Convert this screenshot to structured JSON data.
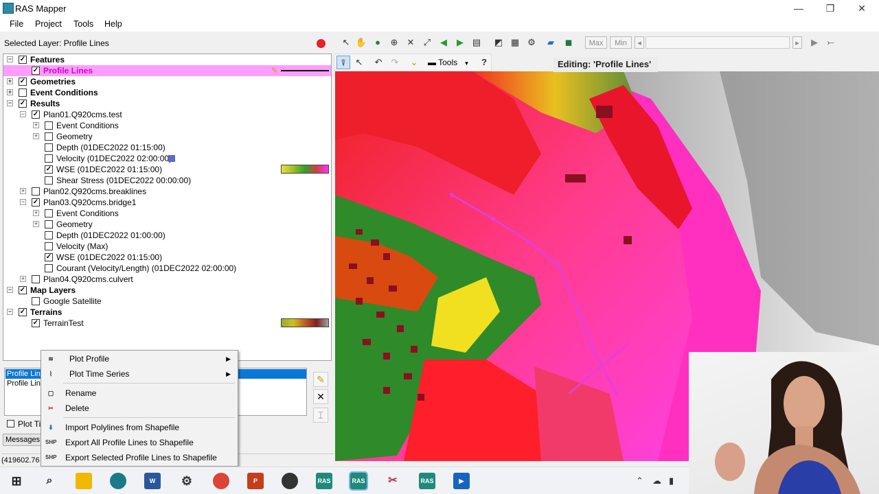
{
  "window": {
    "title": "RAS Mapper",
    "minimize": "—",
    "maximize": "❐",
    "close": "✕"
  },
  "menu": [
    "File",
    "Project",
    "Tools",
    "Help"
  ],
  "selected_layer": "Selected Layer: Profile Lines",
  "tree": [
    {
      "label": "Features",
      "bold": true,
      "checked": true,
      "expander": "−",
      "indent": 0
    },
    {
      "label": "Profile Lines",
      "checked": true,
      "indent": 1,
      "highlight": true
    },
    {
      "label": "Geometries",
      "bold": true,
      "checked": true,
      "expander": "+",
      "indent": 0
    },
    {
      "label": "Event Conditions",
      "bold": true,
      "checked": false,
      "expander": "+",
      "indent": 0
    },
    {
      "label": "Results",
      "bold": true,
      "checked": true,
      "expander": "−",
      "indent": 0
    },
    {
      "label": "Plan01.Q920cms.test",
      "checked": true,
      "expander": "−",
      "indent": 1
    },
    {
      "label": "Event Conditions",
      "checked": false,
      "expander": "+",
      "indent": 2
    },
    {
      "label": "Geometry",
      "checked": false,
      "expander": "+",
      "indent": 2
    },
    {
      "label": "Depth (01DEC2022 01:15:00)",
      "checked": false,
      "indent": 2
    },
    {
      "label": "Velocity (01DEC2022 02:00:00)",
      "checked": false,
      "indent": 2,
      "badge": true
    },
    {
      "label": "WSE (01DEC2022 01:15:00)",
      "checked": true,
      "indent": 2,
      "legend": "wse"
    },
    {
      "label": "Shear Stress (01DEC2022 00:00:00)",
      "checked": false,
      "indent": 2
    },
    {
      "label": "Plan02.Q920cms.breaklines",
      "checked": false,
      "expander": "+",
      "indent": 1
    },
    {
      "label": "Plan03.Q920cms.bridge1",
      "checked": true,
      "expander": "−",
      "indent": 1
    },
    {
      "label": "Event Conditions",
      "checked": false,
      "expander": "+",
      "indent": 2
    },
    {
      "label": "Geometry",
      "checked": false,
      "expander": "+",
      "indent": 2
    },
    {
      "label": "Depth (01DEC2022 01:00:00)",
      "checked": false,
      "indent": 2
    },
    {
      "label": "Velocity (Max)",
      "checked": false,
      "indent": 2
    },
    {
      "label": "WSE (01DEC2022 01:15:00)",
      "checked": true,
      "indent": 2
    },
    {
      "label": "Courant (Velocity/Length) (01DEC2022 02:00:00)",
      "checked": false,
      "indent": 2
    },
    {
      "label": "Plan04.Q920cms.culvert",
      "checked": false,
      "expander": "+",
      "indent": 1
    },
    {
      "label": "Map Layers",
      "bold": true,
      "checked": true,
      "expander": "−",
      "indent": 0
    },
    {
      "label": "Google Satellite",
      "checked": false,
      "indent": 1
    },
    {
      "label": "Terrains",
      "bold": true,
      "checked": true,
      "expander": "−",
      "indent": 0
    },
    {
      "label": "TerrainTest",
      "checked": true,
      "indent": 1,
      "legend": "terrain"
    }
  ],
  "list": {
    "item1": "Profile Line",
    "item2": "Profile Line"
  },
  "plot_toggle": "Plot Ti",
  "messages_tab": "Messages",
  "coords": "(419602.76",
  "toolbar": {
    "max": "Max",
    "min": "Min",
    "tools": "Tools",
    "help": "?"
  },
  "editing_label": "Editing: 'Profile Lines'",
  "context_menu": [
    {
      "label": "Plot Profile",
      "icon": "plot-profile-icon",
      "submenu": true,
      "glyph": "≋"
    },
    {
      "label": "Plot Time Series",
      "icon": "plot-time-series-icon",
      "submenu": true,
      "glyph": "⌇"
    },
    {
      "label": "Rename",
      "icon": "rename-icon",
      "glyph": "▢"
    },
    {
      "label": "Delete",
      "icon": "delete-icon",
      "glyph": "✂"
    },
    {
      "label": "Import Polylines from Shapefile",
      "icon": "import-icon",
      "glyph": "⬇"
    },
    {
      "label": "Export All Profile Lines to Shapefile",
      "icon": "shp-icon",
      "glyph": "SHP"
    },
    {
      "label": "Export Selected Profile Lines to Shapefile",
      "icon": "shp-icon",
      "glyph": "SHP"
    }
  ],
  "taskbar_labels": {
    "ras": "RAS",
    "word": "W",
    "ppt": "P"
  }
}
